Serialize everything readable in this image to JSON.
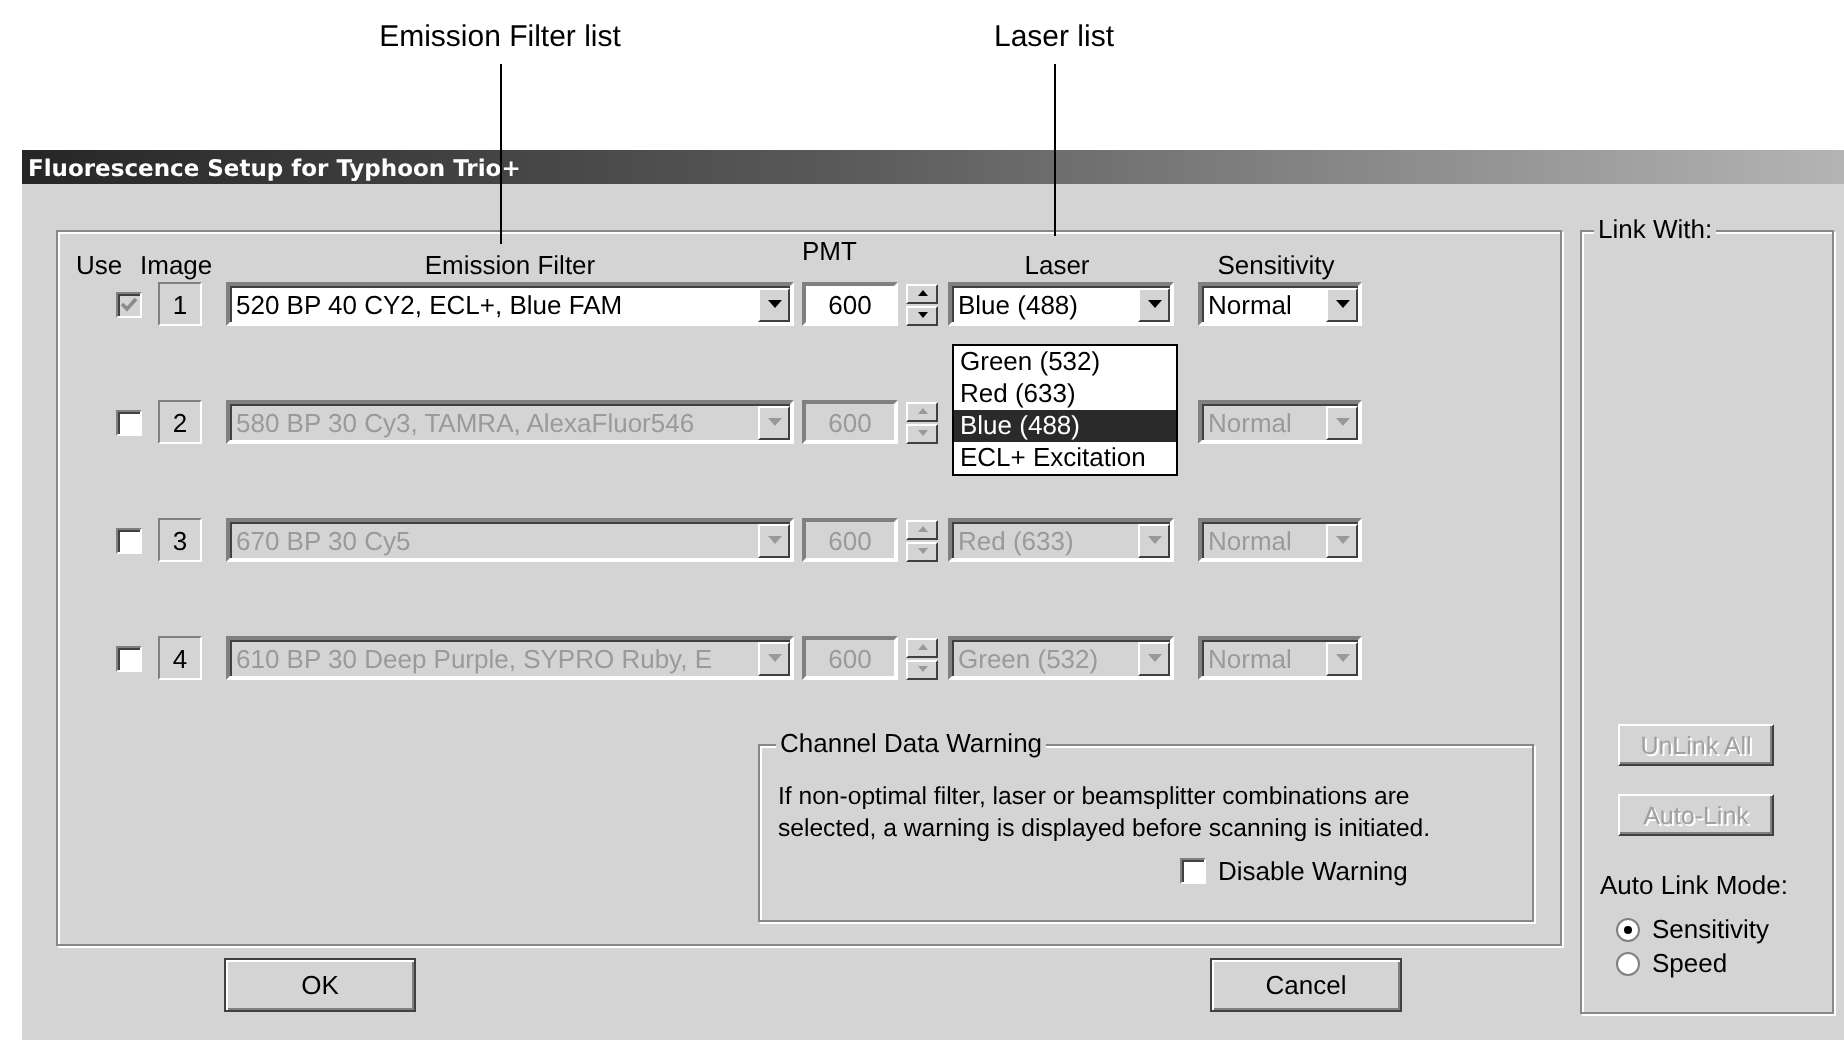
{
  "callouts": [
    {
      "label": "Emission Filter list"
    },
    {
      "label": "Laser list"
    }
  ],
  "window": {
    "title": "Fluorescence Setup for Typhoon Trio+"
  },
  "columns": [
    "Use",
    "Image",
    "Emission Filter",
    "PMT",
    "Laser",
    "Sensitivity"
  ],
  "channels": [
    {
      "checked": true,
      "checkbox_disabled": true,
      "disabled": false,
      "image": "1",
      "filter": "520 BP 40 CY2, ECL+, Blue FAM",
      "pmt": "600",
      "laser": "Blue (488)",
      "sensitivity": "Normal",
      "laser_options": [
        {
          "label": "Green (532)",
          "selected": false
        },
        {
          "label": "Red (633)",
          "selected": false
        },
        {
          "label": "Blue (488)",
          "selected": true
        },
        {
          "label": "ECL+ Excitation",
          "selected": false
        }
      ]
    },
    {
      "checked": false,
      "checkbox_disabled": false,
      "disabled": true,
      "image": "2",
      "filter": "580 BP 30 Cy3, TAMRA, AlexaFluor546",
      "pmt": "600",
      "sensitivity": "Normal"
    },
    {
      "checked": false,
      "checkbox_disabled": false,
      "disabled": true,
      "image": "3",
      "filter": "670 BP 30 Cy5",
      "pmt": "600",
      "laser": "Red (633)",
      "sensitivity": "Normal"
    },
    {
      "checked": false,
      "checkbox_disabled": false,
      "disabled": true,
      "image": "4",
      "filter": "610 BP 30 Deep Purple, SYPRO Ruby, E",
      "pmt": "600",
      "laser": "Green (532)",
      "sensitivity": "Normal"
    }
  ],
  "warning": {
    "title": "Channel Data Warning",
    "text": "If non-optimal filter, laser or beamsplitter combinations are selected, a warning is displayed before scanning is initiated.",
    "disable_warning": {
      "label": "Disable Warning",
      "checked": false
    }
  },
  "link_with": {
    "title": "Link With:",
    "buttons": [
      {
        "label": "UnLink All",
        "disabled": true
      },
      {
        "label": "Auto-Link",
        "disabled": true
      }
    ],
    "mode_label": "Auto Link Mode:",
    "modes": [
      {
        "label": "Sensitivity",
        "selected": true
      },
      {
        "label": "Speed",
        "selected": false
      }
    ]
  },
  "buttons": [
    "OK",
    "Cancel"
  ]
}
